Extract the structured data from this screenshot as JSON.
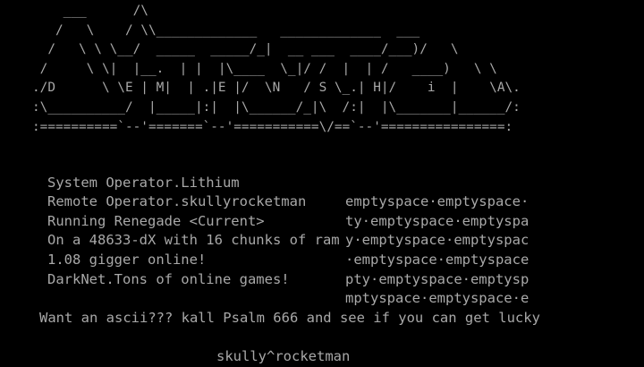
{
  "screen": {
    "background": "#000000",
    "foreground": "#a8a8a8"
  },
  "ascii_art": {
    "lines": [
      "    ___      /\\",
      "   /   \\    / \\\\_____________   _____________  ___",
      "  /   \\ \\ \\__/  _____  _____/_|  __ ___  ____/___)/   \\",
      " /     \\ \\|  |__.  | |  |\\____  \\_|/ /  |  | /   ____)   \\ \\",
      "./D      \\ \\E | M|  | .|E |/  \\N   / S \\_.| H|/    i  |    \\A\\.",
      ":\\__________/  |_____|:|  |\\______/_|\\  /:|  |\\_______|______/:",
      ":==========`--'=======`--'===========\\/==`--'================:"
    ]
  },
  "info_rows": [
    {
      "left": "System Operator.Lithium",
      "right": "emptyspace·emptyspace·"
    },
    {
      "left": "Remote Operator.skullyrocketman",
      "right": "ty·emptyspace·emptyspa"
    },
    {
      "left": "Running Renegade <Current>",
      "right": "y·emptyspace·emptyspac"
    },
    {
      "left": "On a 48633-dX with 16 chunks of ram",
      "right": "·emptyspace·emptyspace"
    },
    {
      "left": "1.08 gigger online!",
      "right": "pty·emptyspace·emptysp"
    },
    {
      "left": "DarkNet.Tons of online games!",
      "right": "mptyspace·emptyspace·e"
    }
  ],
  "bottom_message": "Want an ascii??? kall Psalm 666 and see if you can get lucky",
  "signature": "skully^rocketman"
}
